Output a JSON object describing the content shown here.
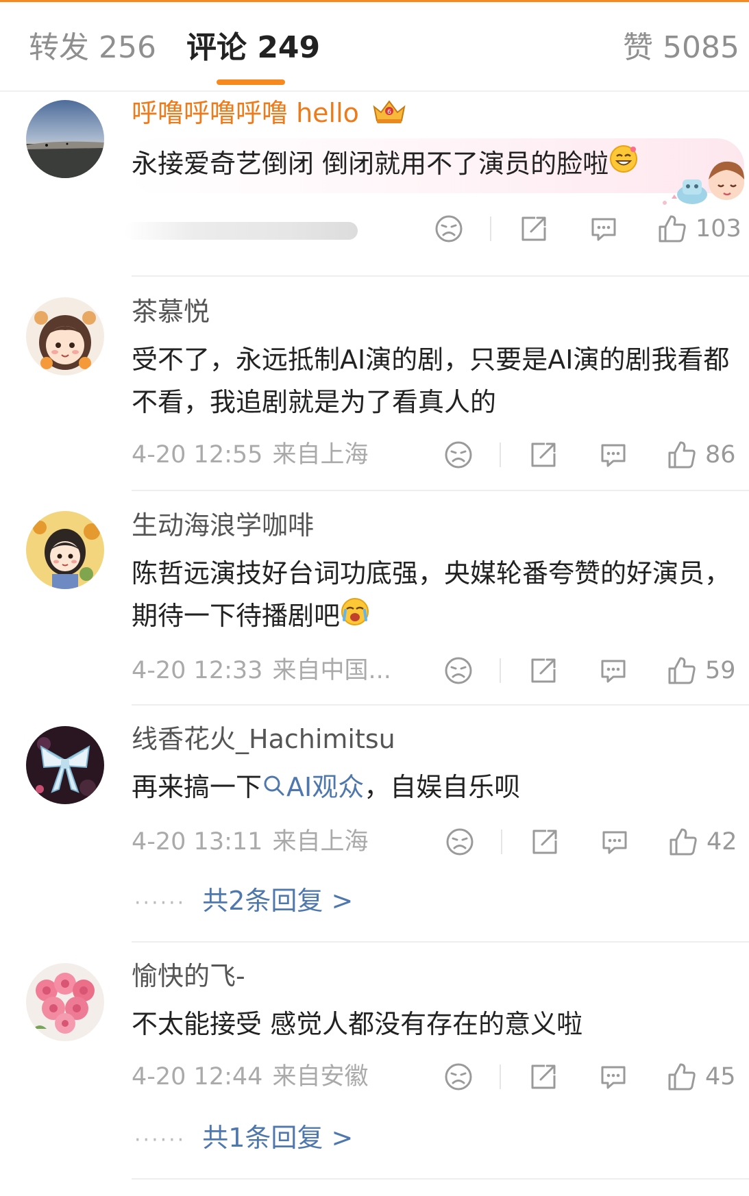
{
  "tabs": {
    "repost": "转发 256",
    "comments": "评论 249",
    "likes": "赞 5085"
  },
  "colors": {
    "accent": "#f78a1e",
    "vip_name": "#ef7a1a",
    "link": "#4e78ad",
    "meta": "#aaaaaa"
  },
  "icons": {
    "dislike": "dislike-face-icon",
    "share": "share-icon",
    "reply": "reply-icon",
    "like": "thumbs-up-icon"
  },
  "comments": [
    {
      "username": "呼噜呼噜呼噜 hello",
      "text": "永接爱奇艺倒闭 倒闭就用不了演员的脸啦",
      "time": "",
      "location": "",
      "likes": "103"
    },
    {
      "username": "茶慕悦",
      "text": "受不了，永远抵制AI演的剧，只要是AI演的剧我看都不看，我追剧就是为了看真人的",
      "time": "4-20 12:55",
      "location": "来自上海",
      "likes": "86"
    },
    {
      "username": "生动海浪学咖啡",
      "text": "陈哲远演技好台词功底强，央媒轮番夸赞的好演员，期待一下待播剧吧",
      "time": "4-20 12:33",
      "location": "来自中国...",
      "likes": "59"
    },
    {
      "username": "线香花火_Hachimitsu",
      "text_before": "再来搞一下",
      "link_text": "AI观众",
      "text_after": "，自娱自乐呗",
      "time": "4-20 13:11",
      "location": "来自上海",
      "likes": "42",
      "replies": "共2条回复 >"
    },
    {
      "username": "愉快的飞-",
      "text": "不太能接受 感觉人都没有存在的意义啦",
      "time": "4-20 12:44",
      "location": "来自安徽",
      "likes": "45",
      "replies": "共1条回复 >"
    }
  ]
}
